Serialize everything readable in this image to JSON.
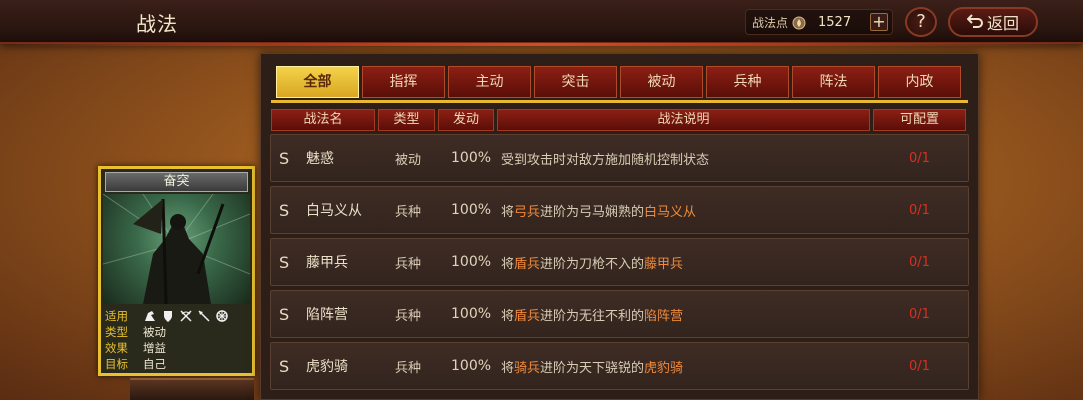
{
  "header": {
    "title": "战法",
    "points_label": "战法点",
    "points_value": "1527",
    "plus": "+",
    "help": "?",
    "back_label": "返回"
  },
  "tabs": [
    {
      "label": "全部",
      "active": true
    },
    {
      "label": "指挥",
      "active": false
    },
    {
      "label": "主动",
      "active": false
    },
    {
      "label": "突击",
      "active": false
    },
    {
      "label": "被动",
      "active": false
    },
    {
      "label": "兵种",
      "active": false
    },
    {
      "label": "阵法",
      "active": false
    },
    {
      "label": "内政",
      "active": false
    }
  ],
  "columns": [
    "战法名",
    "类型",
    "发动",
    "战法说明",
    "可配置"
  ],
  "rows": [
    {
      "grade": "S",
      "name": "魅惑",
      "type": "被动",
      "rate": "100%",
      "desc_parts": [
        {
          "t": "受到攻击时对敌方施加随机控制状态",
          "hl": false
        }
      ],
      "config": "0/1"
    },
    {
      "grade": "S",
      "name": "白马义从",
      "type": "兵种",
      "rate": "100%",
      "desc_parts": [
        {
          "t": "将",
          "hl": false
        },
        {
          "t": "弓兵",
          "hl": true
        },
        {
          "t": "进阶为弓马娴熟的",
          "hl": false
        },
        {
          "t": "白马义从",
          "hl": true
        }
      ],
      "config": "0/1"
    },
    {
      "grade": "S",
      "name": "藤甲兵",
      "type": "兵种",
      "rate": "100%",
      "desc_parts": [
        {
          "t": "将",
          "hl": false
        },
        {
          "t": "盾兵",
          "hl": true
        },
        {
          "t": "进阶为刀枪不入的",
          "hl": false
        },
        {
          "t": "藤甲兵",
          "hl": true
        }
      ],
      "config": "0/1"
    },
    {
      "grade": "S",
      "name": "陷阵营",
      "type": "兵种",
      "rate": "100%",
      "desc_parts": [
        {
          "t": "将",
          "hl": false
        },
        {
          "t": "盾兵",
          "hl": true
        },
        {
          "t": "进阶为无往不利的",
          "hl": false
        },
        {
          "t": "陷阵营",
          "hl": true
        }
      ],
      "config": "0/1"
    },
    {
      "grade": "S",
      "name": "虎豹骑",
      "type": "兵种",
      "rate": "100%",
      "desc_parts": [
        {
          "t": "将",
          "hl": false
        },
        {
          "t": "骑兵",
          "hl": true
        },
        {
          "t": "进阶为天下骁锐的",
          "hl": false
        },
        {
          "t": "虎豹骑",
          "hl": true
        }
      ],
      "config": "0/1"
    }
  ],
  "card": {
    "title": "奋突",
    "use_label": "适用",
    "use_icons": [
      "cavalry-icon",
      "shield-icon",
      "bow-icon",
      "spear-icon",
      "wheel-icon"
    ],
    "type_label": "类型",
    "type_value": "被动",
    "effect_label": "效果",
    "effect_value": "增益",
    "target_label": "目标",
    "target_value": "自己"
  },
  "colors": {
    "tab_active": "#f4d24a",
    "tab_inactive": "#8c1f14",
    "highlight": "#f08a3a",
    "config_red": "#d83020"
  }
}
